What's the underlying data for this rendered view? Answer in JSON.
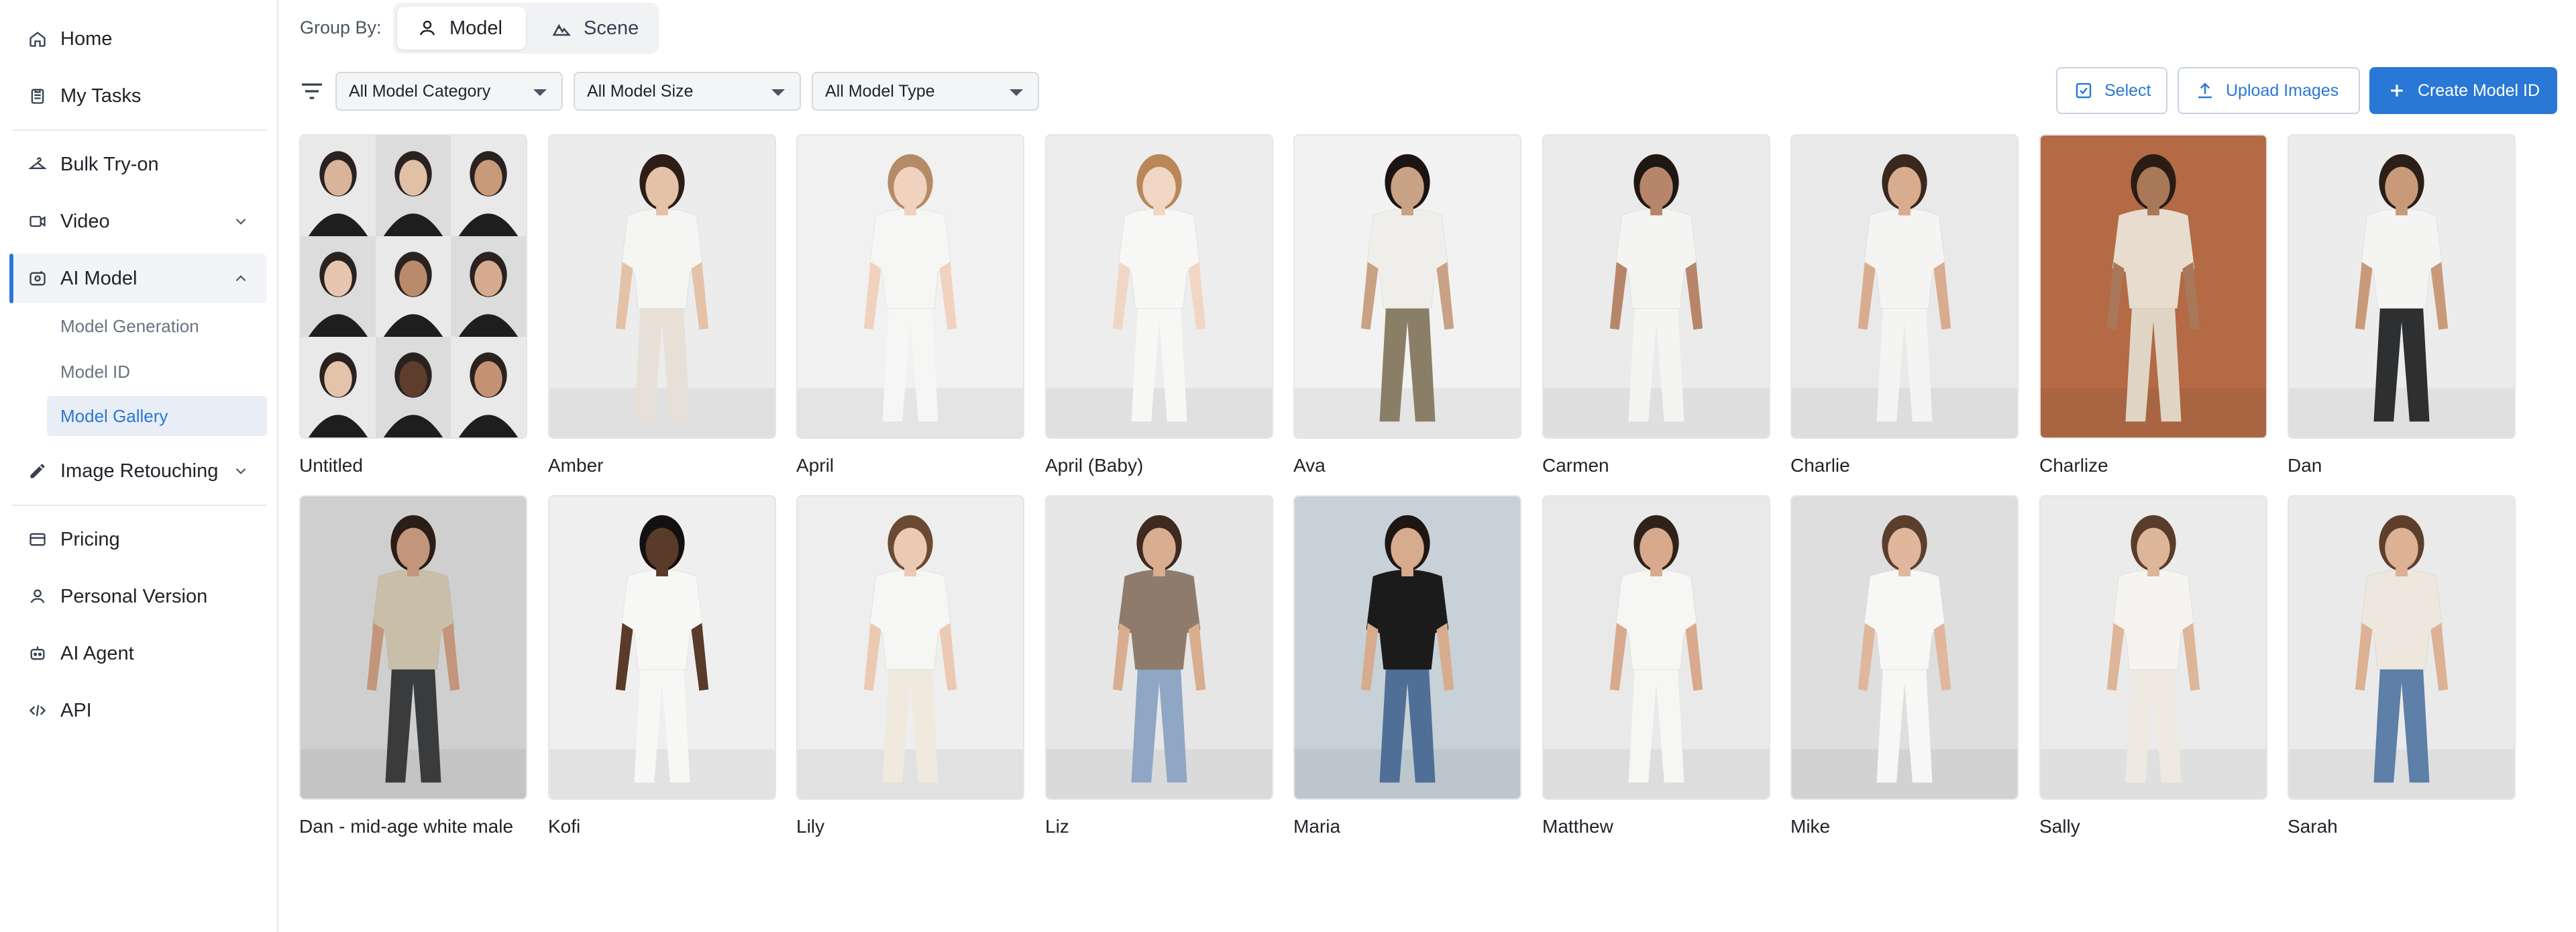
{
  "sidebar": {
    "items": [
      {
        "label": "Home",
        "icon": "home-icon"
      },
      {
        "label": "My Tasks",
        "icon": "clipboard-icon"
      },
      {
        "label": "Bulk Try-on",
        "icon": "hanger-icon"
      },
      {
        "label": "Video",
        "icon": "video-icon"
      },
      {
        "label": "AI Model",
        "icon": "ai-model-icon"
      },
      {
        "label": "Image Retouching",
        "icon": "pencil-icon"
      },
      {
        "label": "Pricing",
        "icon": "card-icon"
      },
      {
        "label": "Personal Version",
        "icon": "person-icon"
      },
      {
        "label": "AI Agent",
        "icon": "robot-icon"
      },
      {
        "label": "API",
        "icon": "code-icon"
      }
    ],
    "ai_model_sub": [
      "Model Generation",
      "Model ID",
      "Model Gallery"
    ]
  },
  "groupby": {
    "label": "Group By:",
    "options": [
      "Model",
      "Scene"
    ],
    "selected": "Model"
  },
  "filters": {
    "category": "All Model Category",
    "size": "All Model Size",
    "type": "All Model Type"
  },
  "actions": {
    "select": "Select",
    "upload": "Upload Images",
    "create": "Create Model ID"
  },
  "gallery": [
    {
      "name": "Untitled",
      "bg": "#e8e8e8",
      "skin": "#d8b49a",
      "hair": "#2a2220",
      "top": "#1e1e1e",
      "bottom": "#1e1e1e"
    },
    {
      "name": "Amber",
      "bg": "#ececec",
      "skin": "#e4c2a8",
      "hair": "#2d1d16",
      "top": "#f5f5f3",
      "bottom": "#e6e0d6"
    },
    {
      "name": "April",
      "bg": "#f1f1f1",
      "skin": "#f1d2be",
      "hair": "#b58a66",
      "top": "#f6f6f4",
      "bottom": "#f6f6f4"
    },
    {
      "name": "April (Baby)",
      "bg": "#ededed",
      "skin": "#f2d6c4",
      "hair": "#b98758",
      "top": "#f7f7f6",
      "bottom": "#f7f7f6"
    },
    {
      "name": "Ava",
      "bg": "#f2f2f2",
      "skin": "#c9a184",
      "hair": "#1b1412",
      "top": "#efeeea",
      "bottom": "#8a7f66"
    },
    {
      "name": "Carmen",
      "bg": "#ebebeb",
      "skin": "#b7866a",
      "hair": "#1f1714",
      "top": "#f4f4f2",
      "bottom": "#f4f4f2"
    },
    {
      "name": "Charlie",
      "bg": "#e9e9e9",
      "skin": "#d8ac8e",
      "hair": "#3a281e",
      "top": "#f4f4f2",
      "bottom": "#f4f4f2"
    },
    {
      "name": "Charlize",
      "bg": "#b36a45",
      "skin": "#a97858",
      "hair": "#2a1c15",
      "top": "#e7dccd",
      "bottom": "#e0d5c4"
    },
    {
      "name": "Dan",
      "bg": "#ececec",
      "skin": "#c99a7a",
      "hair": "#2b1f18",
      "top": "#f4f4f2",
      "bottom": "#2d2f31"
    },
    {
      "name": "Dan - mid-age white male",
      "bg": "#cfcfcf",
      "skin": "#c3957a",
      "hair": "#2a1e17",
      "top": "#c9bfa9",
      "bottom": "#3a3b3c"
    },
    {
      "name": "Kofi",
      "bg": "#efefef",
      "skin": "#5a3a28",
      "hair": "#151010",
      "top": "#f7f7f6",
      "bottom": "#f7f7f6"
    },
    {
      "name": "Lily",
      "bg": "#eeeeee",
      "skin": "#ebc9b2",
      "hair": "#6a4a33",
      "top": "#f6f6f4",
      "bottom": "#efe9de"
    },
    {
      "name": "Liz",
      "bg": "#e6e6e6",
      "skin": "#d9ad8f",
      "hair": "#3e2a20",
      "top": "#8f7b6b",
      "bottom": "#8fa7c4"
    },
    {
      "name": "Maria",
      "bg": "#c8d1d8",
      "skin": "#d7ab8d",
      "hair": "#1e1613",
      "top": "#1b1b1b",
      "bottom": "#4f6f97"
    },
    {
      "name": "Matthew",
      "bg": "#e9e9e9",
      "skin": "#d8a98c",
      "hair": "#2f221b",
      "top": "#f6f6f4",
      "bottom": "#f6f6f4"
    },
    {
      "name": "Mike",
      "bg": "#dedede",
      "skin": "#e0b79c",
      "hair": "#5b3f2c",
      "top": "#f7f7f6",
      "bottom": "#f7f7f6"
    },
    {
      "name": "Sally",
      "bg": "#ebebeb",
      "skin": "#ddb598",
      "hair": "#5a3c2a",
      "top": "#f5f4f1",
      "bottom": "#efeae1"
    },
    {
      "name": "Sarah",
      "bg": "#eaeaea",
      "skin": "#dcb194",
      "hair": "#5e3f2c",
      "top": "#ede7dd",
      "bottom": "#5d7fa8"
    }
  ],
  "colors": {
    "accent": "#2a78d6"
  }
}
